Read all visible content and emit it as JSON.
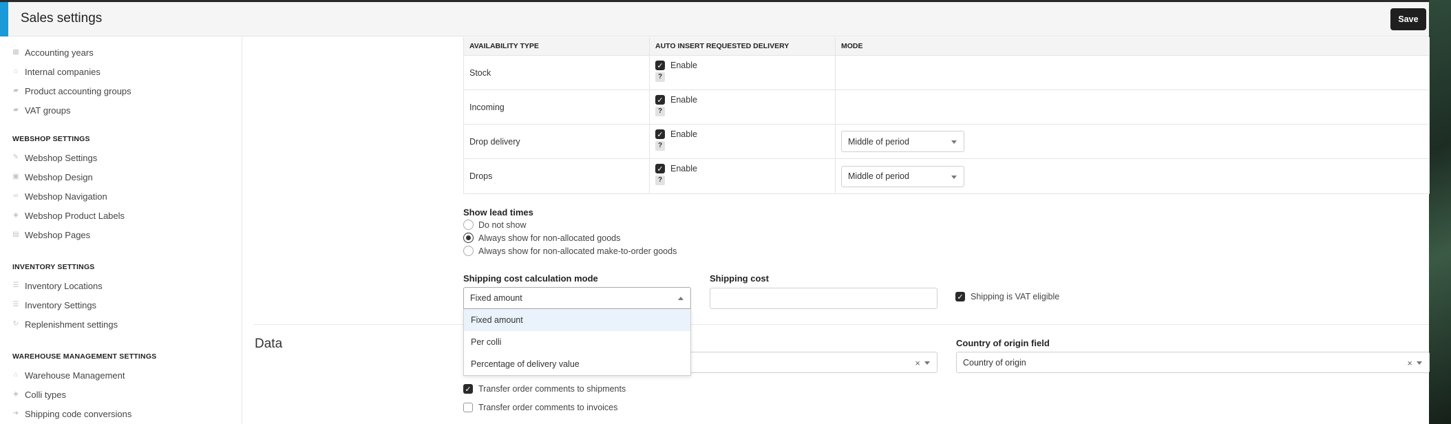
{
  "header": {
    "title": "Sales settings",
    "save_label": "Save"
  },
  "sidebar": {
    "items_top": [
      {
        "label": "Accounting years",
        "icon": "calendar-icon"
      },
      {
        "label": "Internal companies",
        "icon": "home-icon"
      },
      {
        "label": "Product accounting groups",
        "icon": "folder-icon"
      },
      {
        "label": "VAT groups",
        "icon": "folder-icon"
      }
    ],
    "webshop_title": "WEBSHOP SETTINGS",
    "webshop_items": [
      {
        "label": "Webshop Settings",
        "icon": "wrench-icon"
      },
      {
        "label": "Webshop Design",
        "icon": "image-icon"
      },
      {
        "label": "Webshop Navigation",
        "icon": "link-icon"
      },
      {
        "label": "Webshop Product Labels",
        "icon": "tag-icon"
      },
      {
        "label": "Webshop Pages",
        "icon": "page-icon"
      }
    ],
    "inventory_title": "INVENTORY SETTINGS",
    "inventory_items": [
      {
        "label": "Inventory Locations",
        "icon": "list-icon"
      },
      {
        "label": "Inventory Settings",
        "icon": "list-icon"
      },
      {
        "label": "Replenishment settings",
        "icon": "refresh-icon"
      }
    ],
    "warehouse_title": "WAREHOUSE MANAGEMENT SETTINGS",
    "warehouse_items": [
      {
        "label": "Warehouse Management",
        "icon": "home-icon"
      },
      {
        "label": "Colli types",
        "icon": "tag-icon"
      },
      {
        "label": "Shipping code conversions",
        "icon": "arrow-icon"
      }
    ]
  },
  "availability_table": {
    "headers": [
      "AVAILABILITY TYPE",
      "AUTO INSERT REQUESTED DELIVERY",
      "MODE"
    ],
    "enable_label": "Enable",
    "help_label": "?",
    "rows": [
      {
        "type": "Stock",
        "enabled": true,
        "mode": ""
      },
      {
        "type": "Incoming",
        "enabled": true,
        "mode": ""
      },
      {
        "type": "Drop delivery",
        "enabled": true,
        "mode": "Middle of period"
      },
      {
        "type": "Drops",
        "enabled": true,
        "mode": "Middle of period"
      }
    ]
  },
  "lead_times": {
    "label": "Show lead times",
    "options": [
      "Do not show",
      "Always show for non-allocated goods",
      "Always show for non-allocated make-to-order goods"
    ],
    "selected_index": 1
  },
  "shipping": {
    "mode_label": "Shipping cost calculation mode",
    "mode_value": "Fixed amount",
    "mode_options": [
      "Fixed amount",
      "Per colli",
      "Percentage of delivery value"
    ],
    "cost_label": "Shipping cost",
    "cost_value": "",
    "vat_label": "Shipping is VAT eligible",
    "vat_checked": true
  },
  "data_section": {
    "title": "Data",
    "origin_label": "Country of origin field",
    "origin_value": "Country of origin",
    "clear_symbol": "×",
    "transfer_shipments_label": "Transfer order comments to shipments",
    "transfer_shipments_checked": true,
    "transfer_invoices_label": "Transfer order comments to invoices",
    "transfer_invoices_checked": false
  }
}
